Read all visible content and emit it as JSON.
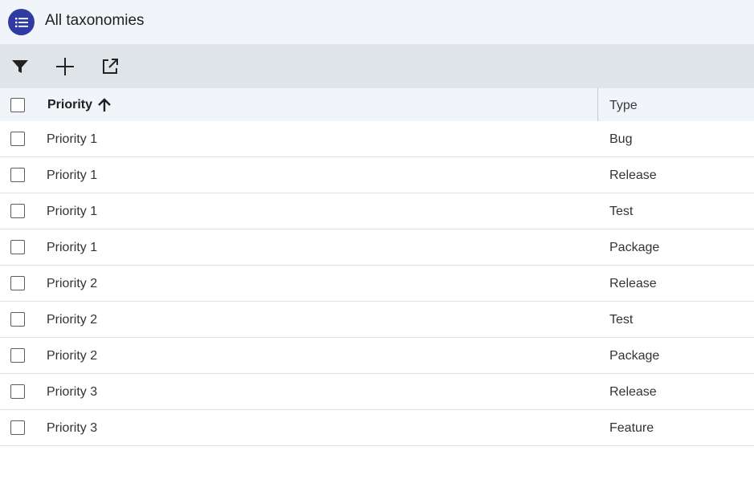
{
  "header": {
    "icon": "list-icon",
    "title": "All taxonomies",
    "accent_color": "#2f3aa3"
  },
  "toolbar": {
    "buttons": [
      {
        "icon": "filter-icon"
      },
      {
        "icon": "plus-icon"
      },
      {
        "icon": "open-external-icon"
      }
    ]
  },
  "table": {
    "columns": [
      {
        "label": "Priority",
        "sort": "ascending",
        "sort_icon": "arrow-up-icon"
      },
      {
        "label": "Type"
      }
    ],
    "rows": [
      {
        "priority": "Priority 1",
        "type": "Bug"
      },
      {
        "priority": "Priority 1",
        "type": "Release"
      },
      {
        "priority": "Priority 1",
        "type": "Test"
      },
      {
        "priority": "Priority 1",
        "type": "Package"
      },
      {
        "priority": "Priority 2",
        "type": "Release"
      },
      {
        "priority": "Priority 2",
        "type": "Test"
      },
      {
        "priority": "Priority 2",
        "type": "Package"
      },
      {
        "priority": "Priority 3",
        "type": "Release"
      },
      {
        "priority": "Priority 3",
        "type": "Feature"
      }
    ]
  }
}
